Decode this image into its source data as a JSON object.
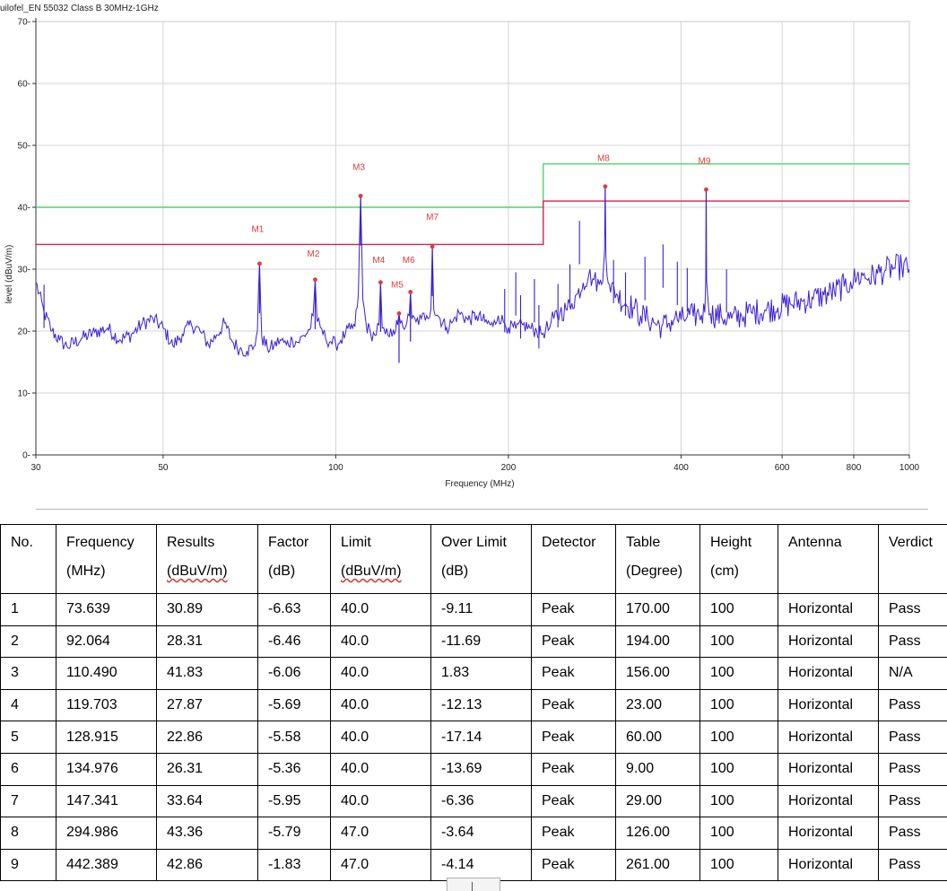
{
  "chart_data": {
    "type": "line",
    "title": "uilofel_EN 55032 Class B 30MHz-1GHz",
    "xlabel": "Frequency (MHz)",
    "ylabel": "level (dBuV/m)",
    "x_scale": "log",
    "xlim": [
      30,
      1000
    ],
    "ylim": [
      0,
      70
    ],
    "x_ticks": [
      30,
      50,
      100,
      200,
      400,
      600,
      800,
      1000
    ],
    "y_ticks": [
      0,
      10,
      20,
      30,
      40,
      50,
      60,
      70
    ],
    "grid": true,
    "colors": {
      "trace": "#3b1fd6",
      "limit": "#4cd66b",
      "margin": "#d6244a",
      "marker": "#e23a3a",
      "grid": "#d4d4d4"
    },
    "limit_line": {
      "name": "limit",
      "segments": [
        {
          "x": [
            30,
            230
          ],
          "y": 40
        },
        {
          "x": [
            230,
            1000
          ],
          "y": 47
        }
      ]
    },
    "margin_line": {
      "name": "limit margin",
      "segments": [
        {
          "x": [
            30,
            230
          ],
          "y": 34
        },
        {
          "x": [
            230,
            1000
          ],
          "y": 41
        }
      ]
    },
    "trace_points": [
      [
        30,
        27.9
      ],
      [
        31,
        23
      ],
      [
        32,
        20
      ],
      [
        33,
        18.5
      ],
      [
        34,
        17.5
      ],
      [
        36,
        18.8
      ],
      [
        38,
        19.8
      ],
      [
        40,
        20.5
      ],
      [
        42,
        18.6
      ],
      [
        44,
        19.4
      ],
      [
        46,
        21.2
      ],
      [
        48,
        22
      ],
      [
        50,
        20.5
      ],
      [
        52,
        17.6
      ],
      [
        54,
        19.5
      ],
      [
        56,
        21.1
      ],
      [
        58,
        20
      ],
      [
        60,
        17.8
      ],
      [
        62,
        19.4
      ],
      [
        64,
        21.3
      ],
      [
        66,
        18.3
      ],
      [
        68,
        17.1
      ],
      [
        70,
        16.8
      ],
      [
        72,
        17.5
      ],
      [
        73,
        20
      ],
      [
        73.64,
        30.89
      ],
      [
        74.3,
        19
      ],
      [
        76,
        17.2
      ],
      [
        78,
        17.6
      ],
      [
        80,
        18.6
      ],
      [
        82,
        17.8
      ],
      [
        84,
        18.6
      ],
      [
        86,
        18.2
      ],
      [
        88,
        19.3
      ],
      [
        90,
        20.2
      ],
      [
        91.3,
        22.5
      ],
      [
        92.06,
        28.31
      ],
      [
        92.8,
        21.5
      ],
      [
        94,
        20.6
      ],
      [
        96,
        18.8
      ],
      [
        98,
        18.3
      ],
      [
        100,
        17.8
      ],
      [
        102,
        18.5
      ],
      [
        104,
        19.6
      ],
      [
        106,
        20.3
      ],
      [
        108,
        20.8
      ],
      [
        109.5,
        26
      ],
      [
        110.49,
        41.83
      ],
      [
        111.5,
        25
      ],
      [
        113,
        21
      ],
      [
        115,
        19.6
      ],
      [
        117,
        19.3
      ],
      [
        118.9,
        21
      ],
      [
        119.7,
        27.87
      ],
      [
        120.5,
        20.5
      ],
      [
        122,
        19.5
      ],
      [
        124,
        19.1
      ],
      [
        126,
        20.2
      ],
      [
        128.2,
        21
      ],
      [
        128.9,
        22.86
      ],
      [
        129.6,
        21.3
      ],
      [
        131,
        20.6
      ],
      [
        133,
        21.3
      ],
      [
        134.3,
        22.5
      ],
      [
        134.98,
        26.31
      ],
      [
        135.7,
        22
      ],
      [
        138,
        21.5
      ],
      [
        141,
        22
      ],
      [
        144,
        22.5
      ],
      [
        146.5,
        23.5
      ],
      [
        147.34,
        33.64
      ],
      [
        148.2,
        23.5
      ],
      [
        152,
        22
      ],
      [
        156,
        20.6
      ],
      [
        160,
        21.5
      ],
      [
        164,
        23
      ],
      [
        170,
        21.8
      ],
      [
        176,
        22.5
      ],
      [
        182,
        21.5
      ],
      [
        188,
        20.8
      ],
      [
        192,
        22.5
      ],
      [
        196,
        21.5
      ],
      [
        200,
        20.6
      ],
      [
        206,
        20.4
      ],
      [
        212,
        21
      ],
      [
        218,
        20.5
      ],
      [
        224,
        20
      ],
      [
        228,
        19.6
      ],
      [
        232,
        20
      ],
      [
        236,
        20.5
      ],
      [
        240,
        22
      ],
      [
        246,
        23
      ],
      [
        252,
        23.5
      ],
      [
        258,
        24.5
      ],
      [
        264,
        26
      ],
      [
        270,
        27.8
      ],
      [
        276,
        29
      ],
      [
        282,
        28.3
      ],
      [
        288,
        27.5
      ],
      [
        292,
        28
      ],
      [
        294.2,
        33
      ],
      [
        294.99,
        43.36
      ],
      [
        295.8,
        32
      ],
      [
        300,
        27.5
      ],
      [
        310,
        25.8
      ],
      [
        320,
        24.5
      ],
      [
        330,
        23.8
      ],
      [
        340,
        22.5
      ],
      [
        350,
        22
      ],
      [
        360,
        21.3
      ],
      [
        370,
        20.8
      ],
      [
        380,
        21.2
      ],
      [
        390,
        22
      ],
      [
        400,
        21.8
      ],
      [
        410,
        22.3
      ],
      [
        420,
        22.4
      ],
      [
        430,
        22.6
      ],
      [
        440,
        23
      ],
      [
        441.6,
        28
      ],
      [
        442.39,
        42.86
      ],
      [
        443.2,
        28
      ],
      [
        450,
        22.8
      ],
      [
        470,
        22.4
      ],
      [
        490,
        22
      ],
      [
        510,
        22.5
      ],
      [
        530,
        23
      ],
      [
        560,
        23.4
      ],
      [
        590,
        23.8
      ],
      [
        620,
        24.4
      ],
      [
        650,
        24.8
      ],
      [
        680,
        25.2
      ],
      [
        710,
        25.8
      ],
      [
        740,
        26.4
      ],
      [
        770,
        27.2
      ],
      [
        790,
        28
      ],
      [
        810,
        28.6
      ],
      [
        830,
        29
      ],
      [
        850,
        28.5
      ],
      [
        880,
        29.3
      ],
      [
        910,
        29.8
      ],
      [
        940,
        30.2
      ],
      [
        970,
        30.4
      ],
      [
        1000,
        30
      ]
    ],
    "spurs": [
      [
        31,
        27.5
      ],
      [
        197,
        26.8
      ],
      [
        206,
        29.5
      ],
      [
        210,
        25.8
      ],
      [
        222,
        28.4
      ],
      [
        226,
        24.2
      ],
      [
        244,
        27.6
      ],
      [
        256,
        30.8
      ],
      [
        266,
        37.8
      ],
      [
        305,
        31.5
      ],
      [
        320,
        29.5
      ],
      [
        346,
        32
      ],
      [
        372,
        34
      ],
      [
        394,
        31.2
      ],
      [
        410,
        30.2
      ],
      [
        480,
        30
      ]
    ],
    "markers": [
      {
        "label": "M1",
        "x": 73.639,
        "y": 30.89,
        "label_y": 36
      },
      {
        "label": "M2",
        "x": 92.064,
        "y": 28.31,
        "label_y": 32
      },
      {
        "label": "M3",
        "x": 110.49,
        "y": 41.83,
        "label_y": 46
      },
      {
        "label": "M4",
        "x": 119.703,
        "y": 27.87,
        "label_y": 31
      },
      {
        "label": "M5",
        "x": 128.915,
        "y": 22.86,
        "label_y": 27
      },
      {
        "label": "M6",
        "x": 134.976,
        "y": 26.31,
        "label_y": 31
      },
      {
        "label": "M7",
        "x": 147.341,
        "y": 33.64,
        "label_y": 38
      },
      {
        "label": "M8",
        "x": 294.986,
        "y": 43.36,
        "label_y": 47.5
      },
      {
        "label": "M9",
        "x": 442.389,
        "y": 42.86,
        "label_y": 47
      }
    ]
  },
  "table": {
    "headers": [
      {
        "main": "No.",
        "unit": ""
      },
      {
        "main": "Frequency",
        "unit": "(MHz)"
      },
      {
        "main": "Results",
        "unit": "(dBuV/m)"
      },
      {
        "main": "Factor",
        "unit": "(dB)"
      },
      {
        "main": "Limit",
        "unit": "(dBuV/m)"
      },
      {
        "main": "Over Limit",
        "unit": "(dB)"
      },
      {
        "main": "Detector",
        "unit": ""
      },
      {
        "main": "Table",
        "unit": "(Degree)"
      },
      {
        "main": "Height",
        "unit": "(cm)"
      },
      {
        "main": "Antenna",
        "unit": ""
      },
      {
        "main": "Verdict",
        "unit": ""
      }
    ],
    "rows": [
      [
        "1",
        "73.639",
        "30.89",
        "-6.63",
        "40.0",
        "-9.11",
        "Peak",
        "170.00",
        "100",
        "Horizontal",
        "Pass"
      ],
      [
        "2",
        "92.064",
        "28.31",
        "-6.46",
        "40.0",
        "-11.69",
        "Peak",
        "194.00",
        "100",
        "Horizontal",
        "Pass"
      ],
      [
        "3",
        "110.490",
        "41.83",
        "-6.06",
        "40.0",
        "1.83",
        "Peak",
        "156.00",
        "100",
        "Horizontal",
        "N/A"
      ],
      [
        "4",
        "119.703",
        "27.87",
        "-5.69",
        "40.0",
        "-12.13",
        "Peak",
        "23.00",
        "100",
        "Horizontal",
        "Pass"
      ],
      [
        "5",
        "128.915",
        "22.86",
        "-5.58",
        "40.0",
        "-17.14",
        "Peak",
        "60.00",
        "100",
        "Horizontal",
        "Pass"
      ],
      [
        "6",
        "134.976",
        "26.31",
        "-5.36",
        "40.0",
        "-13.69",
        "Peak",
        "9.00",
        "100",
        "Horizontal",
        "Pass"
      ],
      [
        "7",
        "147.341",
        "33.64",
        "-5.95",
        "40.0",
        "-6.36",
        "Peak",
        "29.00",
        "100",
        "Horizontal",
        "Pass"
      ],
      [
        "8",
        "294.986",
        "43.36",
        "-5.79",
        "47.0",
        "-3.64",
        "Peak",
        "126.00",
        "100",
        "Horizontal",
        "Pass"
      ],
      [
        "9",
        "442.389",
        "42.86",
        "-1.83",
        "47.0",
        "-4.14",
        "Peak",
        "261.00",
        "100",
        "Horizontal",
        "Pass"
      ]
    ]
  }
}
